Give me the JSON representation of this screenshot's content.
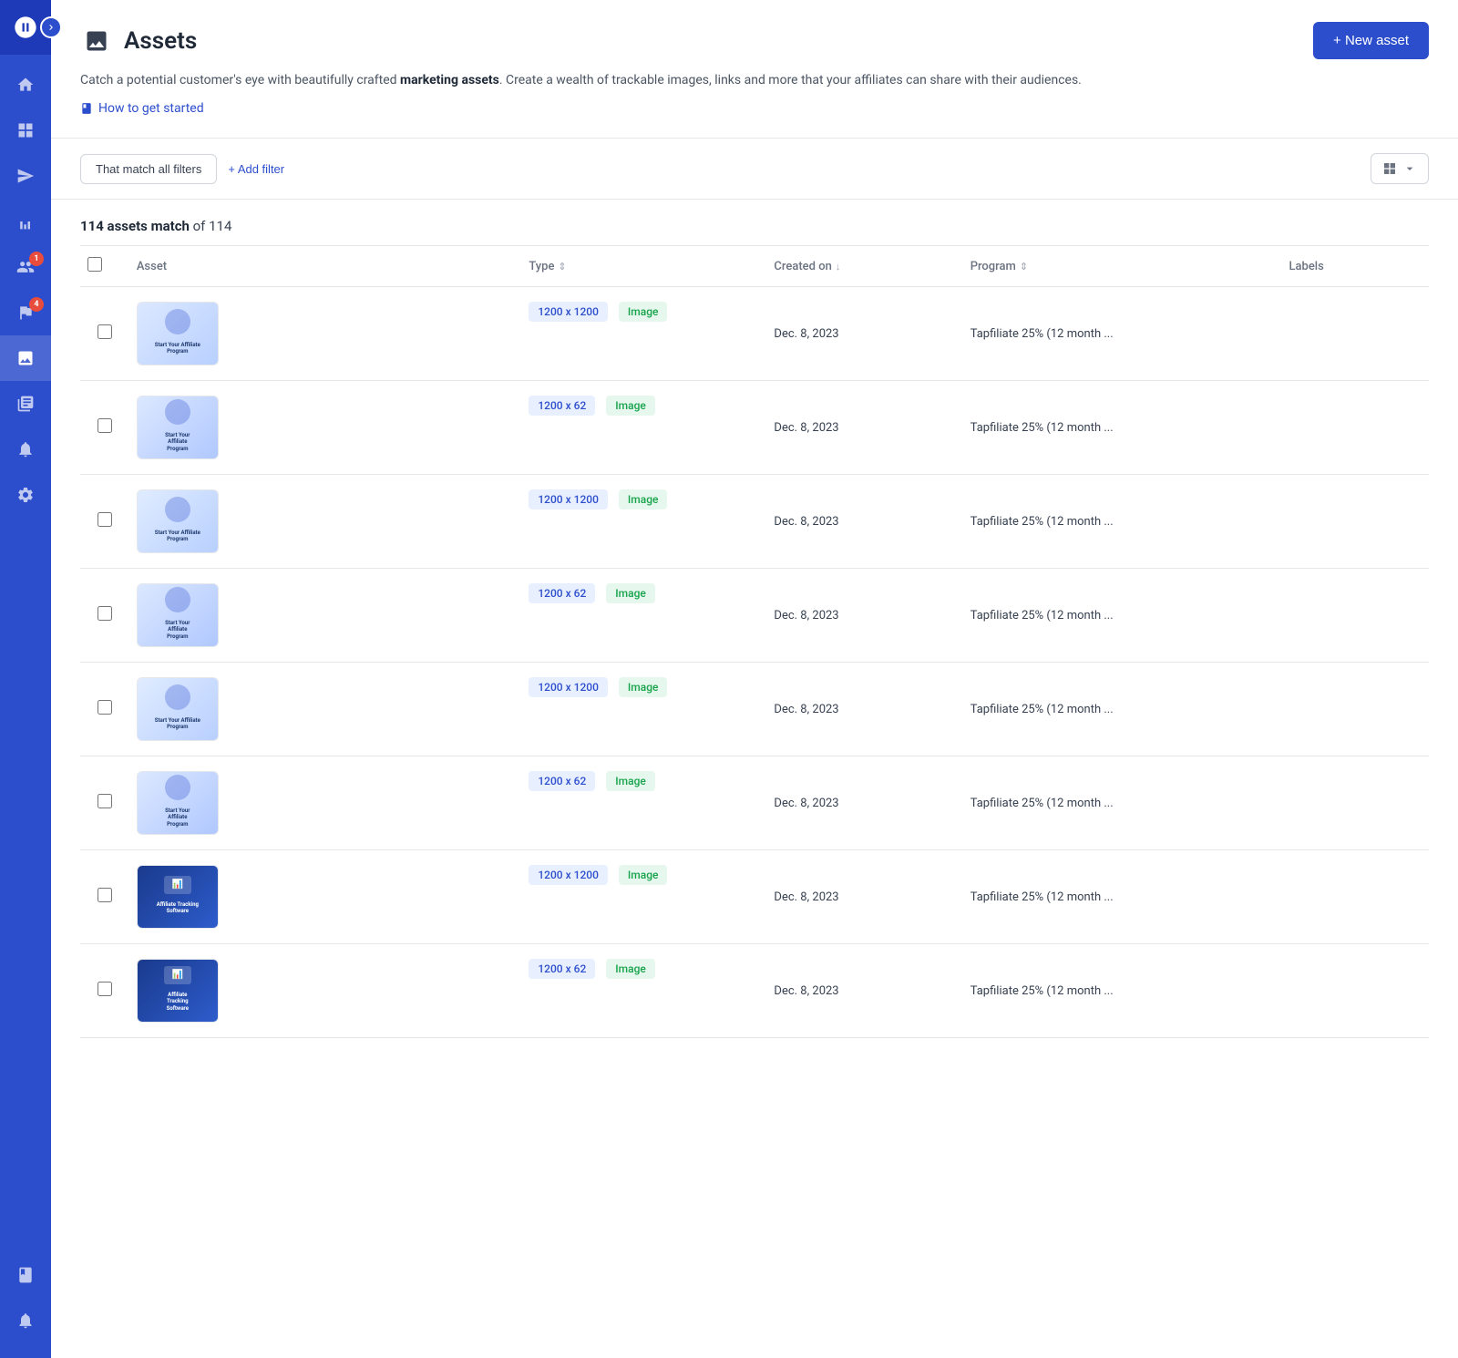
{
  "sidebar": {
    "toggle_label": "›",
    "nav_items": [
      {
        "id": "home",
        "icon": "home",
        "active": false,
        "badge": null
      },
      {
        "id": "dashboard",
        "icon": "dashboard",
        "active": false,
        "badge": null
      },
      {
        "id": "campaigns",
        "icon": "send",
        "active": false,
        "badge": null
      },
      {
        "id": "analytics",
        "icon": "chart",
        "active": false,
        "badge": null
      },
      {
        "id": "affiliates",
        "icon": "people",
        "active": false,
        "badge": "1"
      },
      {
        "id": "flags",
        "icon": "flag",
        "active": false,
        "badge": "4"
      },
      {
        "id": "assets",
        "icon": "assets",
        "active": true,
        "badge": null
      },
      {
        "id": "media",
        "icon": "media",
        "active": false,
        "badge": null
      },
      {
        "id": "alerts",
        "icon": "alert",
        "active": false,
        "badge": null
      },
      {
        "id": "settings",
        "icon": "settings",
        "active": false,
        "badge": null
      }
    ],
    "bottom_items": [
      {
        "id": "docs",
        "icon": "book"
      },
      {
        "id": "notifications",
        "icon": "bell"
      }
    ]
  },
  "header": {
    "page_icon": "image",
    "page_title": "Assets",
    "new_asset_btn": "+ New asset",
    "description_part1": "Catch a potential customer's eye with beautifully crafted ",
    "description_bold": "marketing assets",
    "description_part2": ". Create a wealth of trackable images, links and more that your affiliates can share with their audiences.",
    "help_link_text": "How to get started"
  },
  "filters": {
    "match_label": "That match all filters",
    "add_filter_label": "+ Add filter",
    "view_label": ""
  },
  "table": {
    "match_count": "114 assets match",
    "match_total": " of 114",
    "columns": {
      "asset": "Asset",
      "type": "Type",
      "created_on": "Created on",
      "program": "Program",
      "labels": "Labels"
    },
    "rows": [
      {
        "thumb_class": "thumb-1",
        "thumb_lines": [
          "Start Your Affiliate",
          "Program"
        ],
        "dark": false,
        "size": "1200 x 1200",
        "type": "Image",
        "created": "Dec. 8, 2023",
        "program": "Tapfiliate 25% (12 month ..."
      },
      {
        "thumb_class": "thumb-2",
        "thumb_lines": [
          "Start Your",
          "Affiliate",
          "Program"
        ],
        "dark": false,
        "size": "1200 x 62",
        "type": "Image",
        "created": "Dec. 8, 2023",
        "program": "Tapfiliate 25% (12 month ..."
      },
      {
        "thumb_class": "thumb-3",
        "thumb_lines": [
          "Start Your Affiliate",
          "Program"
        ],
        "dark": false,
        "size": "1200 x 1200",
        "type": "Image",
        "created": "Dec. 8, 2023",
        "program": "Tapfiliate 25% (12 month ..."
      },
      {
        "thumb_class": "thumb-4",
        "thumb_lines": [
          "Start Your",
          "Affiliate",
          "Program"
        ],
        "dark": false,
        "size": "1200 x 62",
        "type": "Image",
        "created": "Dec. 8, 2023",
        "program": "Tapfiliate 25% (12 month ..."
      },
      {
        "thumb_class": "thumb-5",
        "thumb_lines": [
          "Start Your Affiliate",
          "Program"
        ],
        "dark": false,
        "size": "1200 x 1200",
        "type": "Image",
        "created": "Dec. 8, 2023",
        "program": "Tapfiliate 25% (12 month ..."
      },
      {
        "thumb_class": "thumb-6",
        "thumb_lines": [
          "Start Your",
          "Affiliate",
          "Program"
        ],
        "dark": false,
        "size": "1200 x 62",
        "type": "Image",
        "created": "Dec. 8, 2023",
        "program": "Tapfiliate 25% (12 month ..."
      },
      {
        "thumb_class": "thumb-7",
        "thumb_lines": [
          "Affiliate Tracking",
          "Software"
        ],
        "dark": true,
        "size": "1200 x 1200",
        "type": "Image",
        "created": "Dec. 8, 2023",
        "program": "Tapfiliate 25% (12 month ..."
      },
      {
        "thumb_class": "thumb-8",
        "thumb_lines": [
          "Affiliate",
          "Tracking",
          "Software"
        ],
        "dark": true,
        "size": "1200 x 62",
        "type": "Image",
        "created": "Dec. 8, 2023",
        "program": "Tapfiliate 25% (12 month ..."
      }
    ]
  }
}
